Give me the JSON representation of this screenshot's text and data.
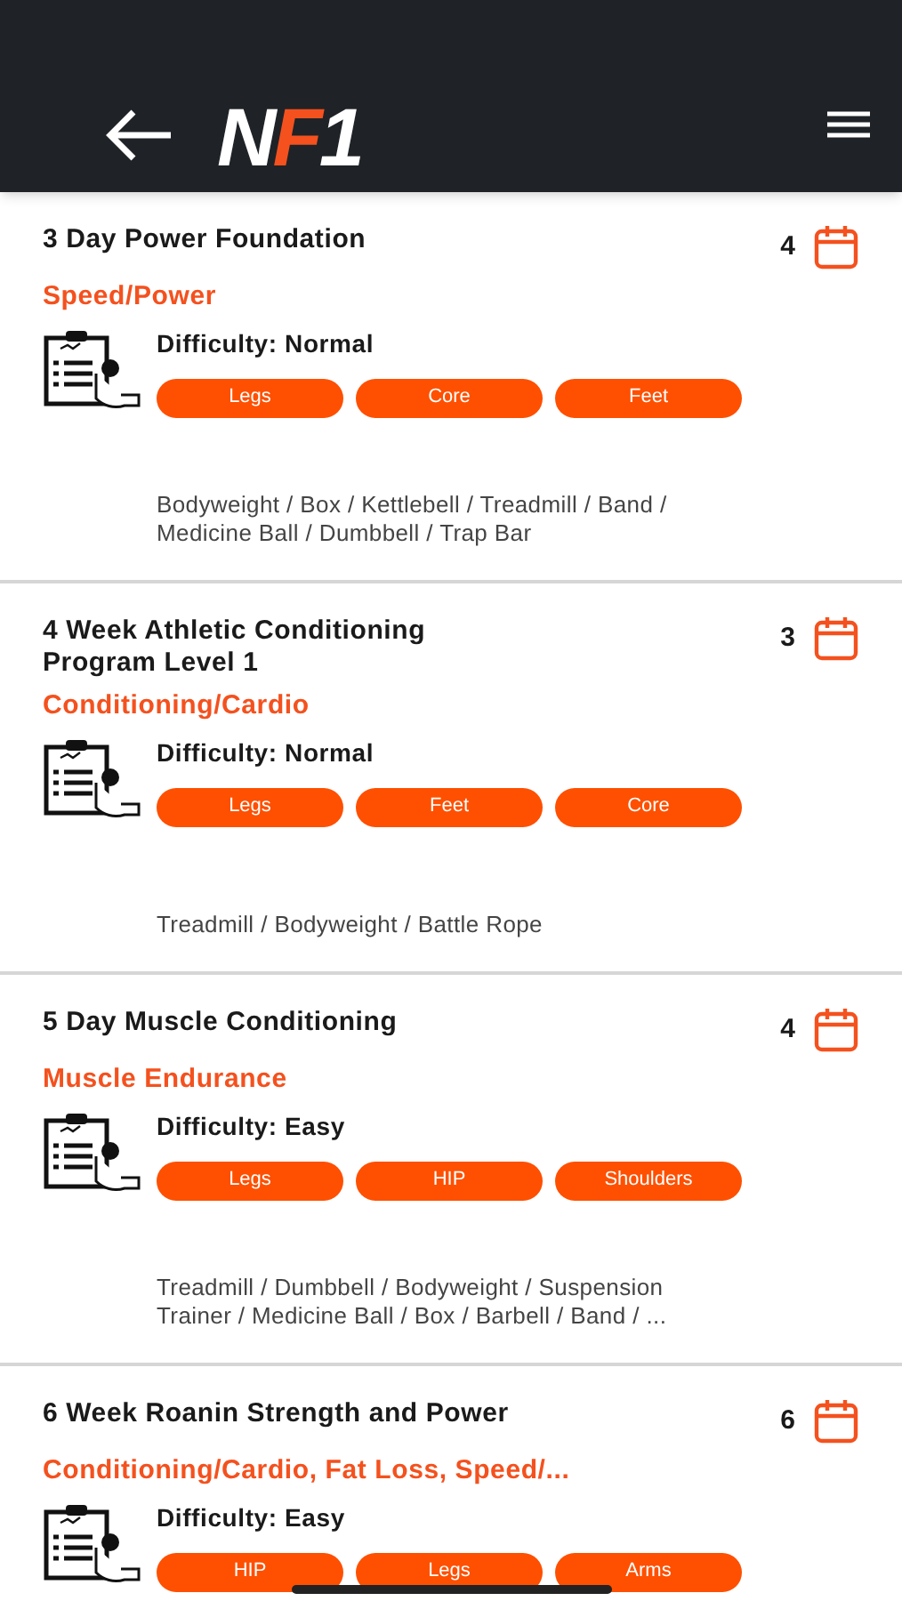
{
  "header": {
    "logo": [
      {
        "text": "N",
        "color": "#ffffff"
      },
      {
        "text": "F",
        "color": "#f4511e"
      },
      {
        "text": "1",
        "color": "#ffffff"
      }
    ]
  },
  "programs": [
    {
      "title": "3 Day Power Foundation",
      "days": "4",
      "category": "Speed/Power",
      "difficulty": "Difficulty: Normal",
      "tags": [
        "Legs",
        "Core",
        "Feet"
      ],
      "equipment": "Bodyweight / Box / Kettlebell / Treadmill / Band / Medicine Ball / Dumbbell / Trap Bar"
    },
    {
      "title": "4 Week Athletic Conditioning Program Level 1",
      "days": "3",
      "category": "Conditioning/Cardio",
      "difficulty": "Difficulty: Normal",
      "tags": [
        "Legs",
        "Feet",
        "Core"
      ],
      "equipment": "Treadmill / Bodyweight / Battle Rope"
    },
    {
      "title": "5 Day Muscle Conditioning",
      "days": "4",
      "category": "Muscle Endurance",
      "difficulty": "Difficulty: Easy",
      "tags": [
        "Legs",
        "HIP",
        "Shoulders"
      ],
      "equipment": "Treadmill / Dumbbell / Bodyweight / Suspension Trainer / Medicine Ball / Box / Barbell / Band / ..."
    },
    {
      "title": "6 Week Roanin Strength and Power",
      "days": "6",
      "category": "Conditioning/Cardio, Fat Loss, Speed/...",
      "difficulty": "Difficulty: Easy",
      "tags": [
        "HIP",
        "Legs",
        "Arms"
      ]
    }
  ]
}
